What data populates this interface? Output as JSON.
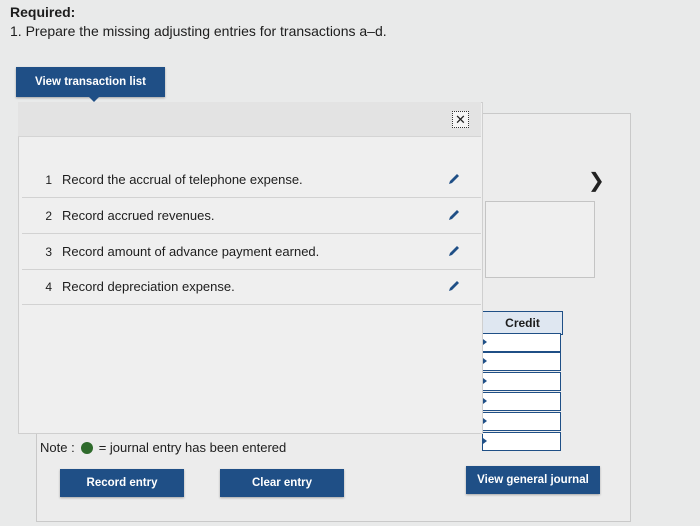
{
  "header": {
    "required_label": "Required:",
    "item_text": "1. Prepare the missing adjusting entries for transactions a–d."
  },
  "buttons": {
    "view_transaction_list": "View transaction list",
    "record_entry": "Record entry",
    "clear_entry": "Clear entry",
    "view_general_journal": "View general journal"
  },
  "transactions": [
    {
      "num": "1",
      "desc": "Record the accrual of telephone expense."
    },
    {
      "num": "2",
      "desc": "Record accrued revenues."
    },
    {
      "num": "3",
      "desc": "Record amount of advance payment earned."
    },
    {
      "num": "4",
      "desc": "Record depreciation expense."
    }
  ],
  "journal": {
    "credit_header": "Credit"
  },
  "note": {
    "prefix": "Note :",
    "suffix": "= journal entry has been entered",
    "dot_color": "#2f6b2c"
  },
  "colors": {
    "accent": "#1f4f86"
  }
}
